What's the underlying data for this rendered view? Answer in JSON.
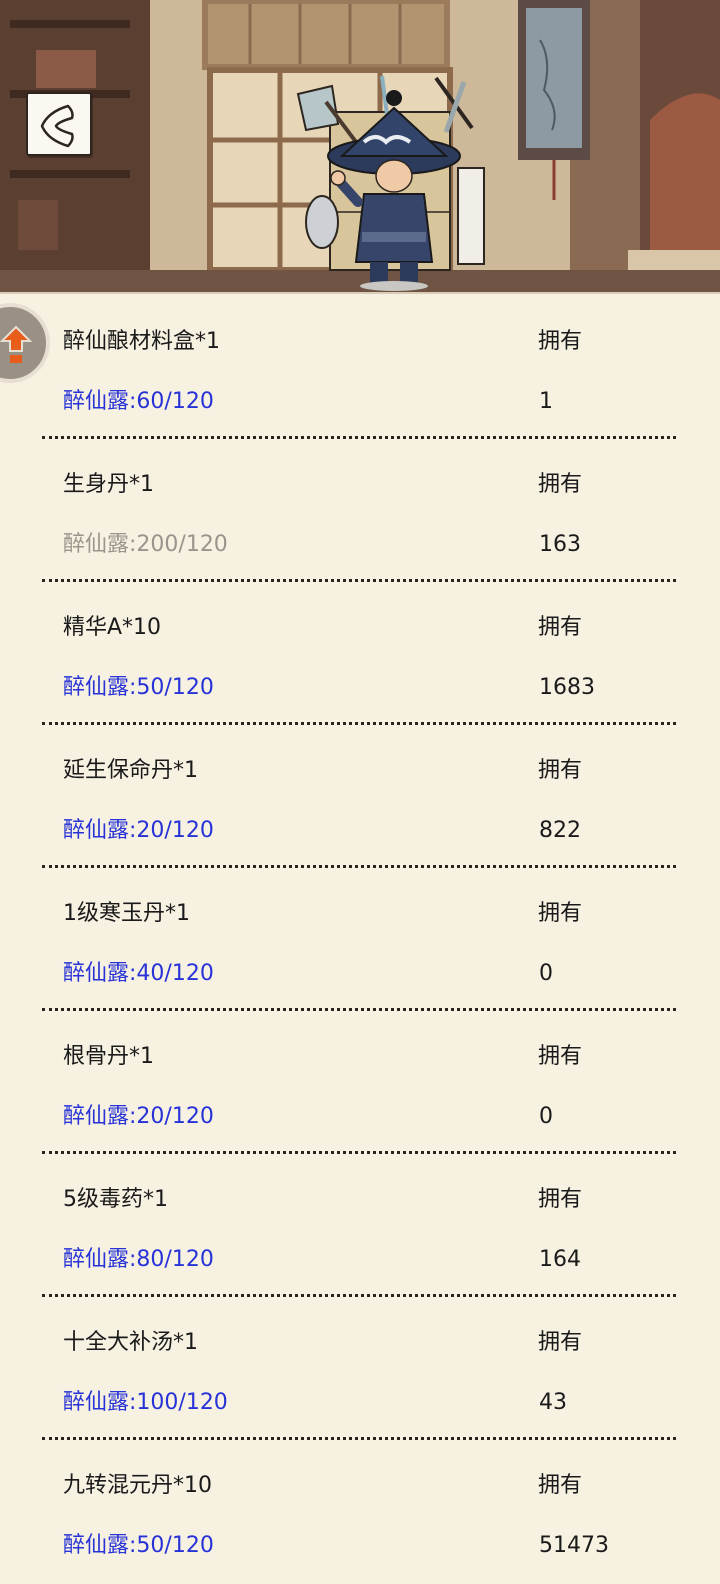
{
  "header": {
    "back_icon": "chevron-left-icon",
    "side_tab_icon": "arrow-loop-icon"
  },
  "colors": {
    "cost_affordable": "#2733d6",
    "cost_insufficient": "#9a948c",
    "text": "#1a1a1a",
    "panel_bg": "#f7f1e2"
  },
  "items": [
    {
      "name": "醉仙酿材料盒*1",
      "cost": "醉仙露:60/120",
      "owned_label": "拥有",
      "owned": "1",
      "affordable": true
    },
    {
      "name": "生身丹*1",
      "cost": "醉仙露:200/120",
      "owned_label": "拥有",
      "owned": "163",
      "affordable": false
    },
    {
      "name": "精华A*10",
      "cost": "醉仙露:50/120",
      "owned_label": "拥有",
      "owned": "1683",
      "affordable": true
    },
    {
      "name": "延生保命丹*1",
      "cost": "醉仙露:20/120",
      "owned_label": "拥有",
      "owned": "822",
      "affordable": true
    },
    {
      "name": "1级寒玉丹*1",
      "cost": "醉仙露:40/120",
      "owned_label": "拥有",
      "owned": "0",
      "affordable": true
    },
    {
      "name": "根骨丹*1",
      "cost": "醉仙露:20/120",
      "owned_label": "拥有",
      "owned": "0",
      "affordable": true
    },
    {
      "name": "5级毒药*1",
      "cost": "醉仙露:80/120",
      "owned_label": "拥有",
      "owned": "164",
      "affordable": true
    },
    {
      "name": "十全大补汤*1",
      "cost": "醉仙露:100/120",
      "owned_label": "拥有",
      "owned": "43",
      "affordable": true
    },
    {
      "name": "九转混元丹*10",
      "cost": "醉仙露:50/120",
      "owned_label": "拥有",
      "owned": "51473",
      "affordable": true
    }
  ]
}
